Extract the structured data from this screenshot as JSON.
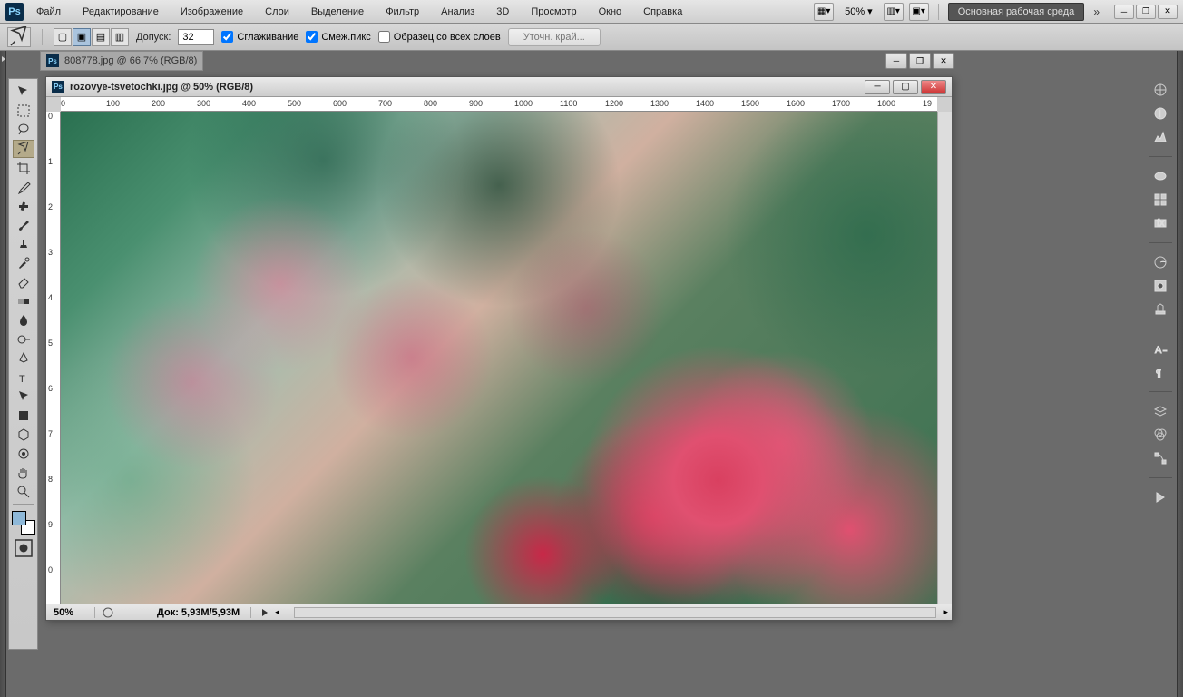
{
  "app": {
    "logo": "Ps"
  },
  "menubar": [
    "Файл",
    "Редактирование",
    "Изображение",
    "Слои",
    "Выделение",
    "Фильтр",
    "Анализ",
    "3D",
    "Просмотр",
    "Окно",
    "Справка"
  ],
  "topright": {
    "zoom": "50%",
    "workspace": "Основная рабочая среда",
    "chevrons": "»"
  },
  "optbar": {
    "tolerance_label": "Допуск:",
    "tolerance_value": "32",
    "antialias": "Сглаживание",
    "contiguous": "Смеж.пикс",
    "allLayers": "Образец со всех слоев",
    "refine": "Уточн. край..."
  },
  "bgdoc": {
    "title": "808778.jpg @ 66,7% (RGB/8)"
  },
  "doc": {
    "title": "rozovye-tsvetochki.jpg @ 50% (RGB/8)",
    "zoom": "50%",
    "docinfo": "Док: 5,93M/5,93M"
  },
  "ruler_h": [
    "0",
    "100",
    "200",
    "300",
    "400",
    "500",
    "600",
    "700",
    "800",
    "900",
    "1000",
    "1100",
    "1200",
    "1300",
    "1400",
    "1500",
    "1600",
    "1700",
    "1800",
    "19"
  ],
  "ruler_v": [
    "0",
    "1",
    "2",
    "3",
    "4",
    "5",
    "6",
    "7",
    "8",
    "9",
    "0"
  ]
}
